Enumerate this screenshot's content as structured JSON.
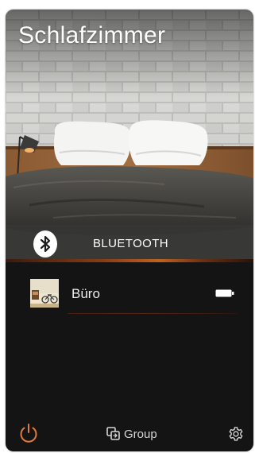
{
  "room": {
    "title": "Schlafzimmer"
  },
  "source": {
    "icon": "bluetooth-icon",
    "label": "BLUETOOTH"
  },
  "speakers": [
    {
      "name": "Büro",
      "thumbnail_icon": "speaker-thumbnail",
      "status_icon": "battery-icon"
    }
  ],
  "toolbar": {
    "power_icon": "power-icon",
    "group_icon": "group-icon",
    "group_label": "Group",
    "settings_icon": "gear-icon"
  },
  "colors": {
    "accent": "#e07a3f",
    "background": "#141414",
    "text": "#ececec"
  }
}
